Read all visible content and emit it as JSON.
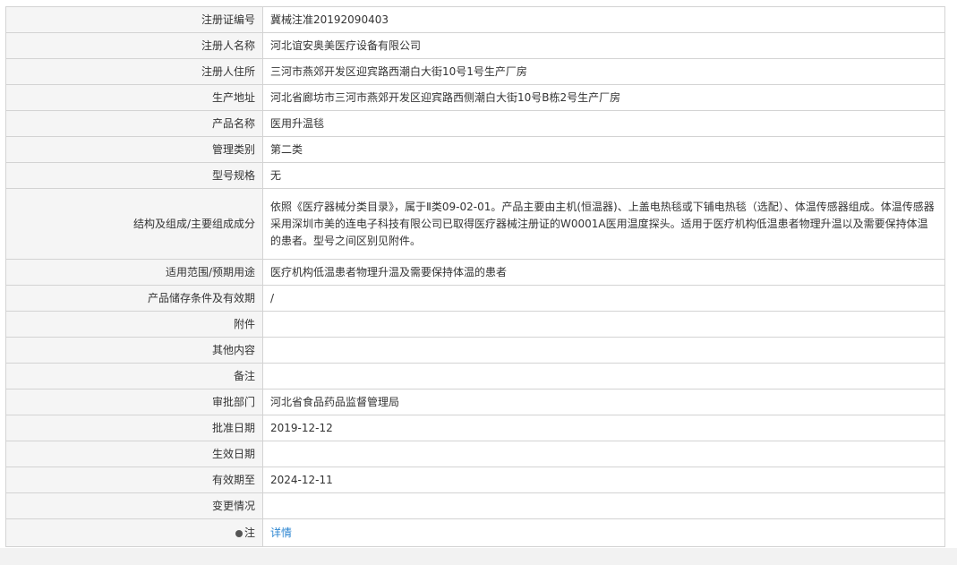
{
  "rows": [
    {
      "label": "注册证编号",
      "value": "冀械注准20192090403"
    },
    {
      "label": "注册人名称",
      "value": "河北谊安奥美医疗设备有限公司"
    },
    {
      "label": "注册人住所",
      "value": "三河市燕郊开发区迎宾路西潮白大街10号1号生产厂房"
    },
    {
      "label": "生产地址",
      "value": "河北省廊坊市三河市燕郊开发区迎宾路西侧潮白大街10号B栋2号生产厂房"
    },
    {
      "label": "产品名称",
      "value": "医用升温毯"
    },
    {
      "label": "管理类别",
      "value": "第二类"
    },
    {
      "label": "型号规格",
      "value": "无"
    },
    {
      "label": "结构及组成/主要组成成分",
      "value": "依照《医疗器械分类目录》，属于Ⅱ类09-02-01。产品主要由主机(恒温器)、上盖电热毯或下铺电热毯（选配）、体温传感器组成。体温传感器采用深圳市美的连电子科技有限公司已取得医疗器械注册证的W0001A医用温度探头。适用于医疗机构低温患者物理升温以及需要保持体温的患者。型号之间区别见附件。"
    },
    {
      "label": "适用范围/预期用途",
      "value": "医疗机构低温患者物理升温及需要保持体温的患者"
    },
    {
      "label": "产品储存条件及有效期",
      "value": "/"
    },
    {
      "label": "附件",
      "value": ""
    },
    {
      "label": "其他内容",
      "value": ""
    },
    {
      "label": "备注",
      "value": ""
    },
    {
      "label": "审批部门",
      "value": "河北省食品药品监督管理局"
    },
    {
      "label": "批准日期",
      "value": "2019-12-12"
    },
    {
      "label": "生效日期",
      "value": ""
    },
    {
      "label": "有效期至",
      "value": "2024-12-11"
    },
    {
      "label": "变更情况",
      "value": ""
    }
  ],
  "note": {
    "label": "注",
    "link_text": "详情",
    "icon": "location-pin-icon"
  }
}
